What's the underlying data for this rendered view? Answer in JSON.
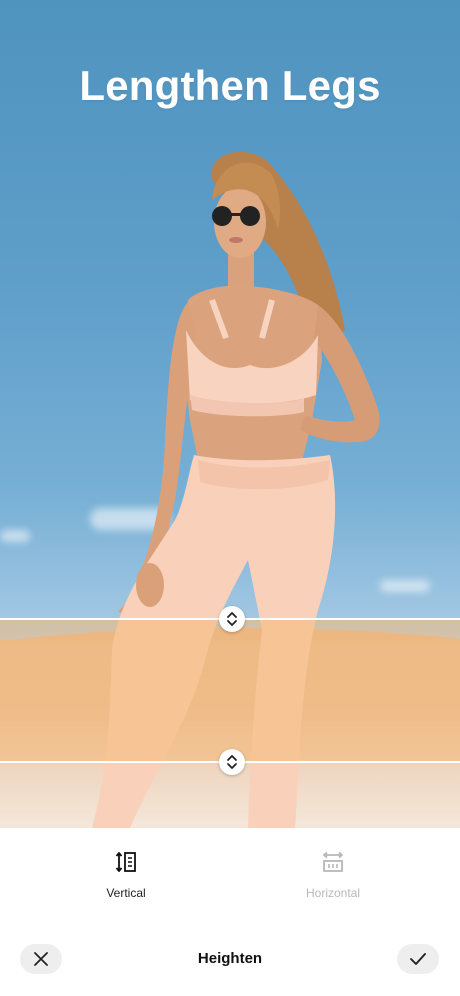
{
  "headline": "Lengthen Legs",
  "modes": {
    "vertical": {
      "label": "Vertical",
      "icon": "vertical-stretch-icon",
      "selected": true
    },
    "horizontal": {
      "label": "Horizontal",
      "icon": "horizontal-stretch-icon",
      "selected": false
    }
  },
  "toolbar": {
    "title": "Heighten",
    "cancel_icon": "close-icon",
    "confirm_icon": "checkmark-icon"
  },
  "colors": {
    "sky": "#5f9fca",
    "selection_band": "#f5ba78",
    "active_text": "#222222",
    "inactive_text": "#b8b8b8"
  }
}
